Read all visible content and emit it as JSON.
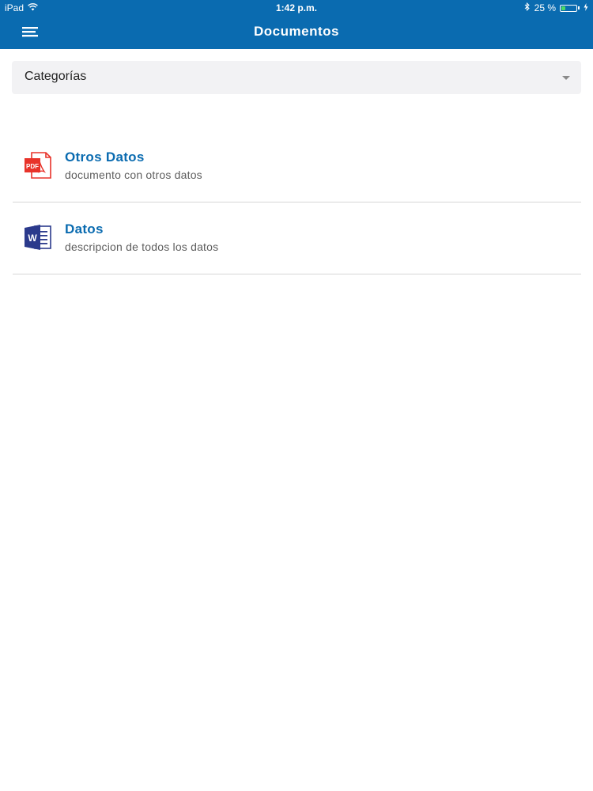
{
  "status_bar": {
    "device": "iPad",
    "time": "1:42 p.m.",
    "battery": "25 %",
    "battery_level": 0.25,
    "icons": [
      "wifi-icon",
      "bluetooth-icon",
      "battery-icon",
      "charging-icon"
    ]
  },
  "nav": {
    "title": "Documentos",
    "menu_icon": "menu-icon"
  },
  "category_select": {
    "label": "Categorías",
    "caret_icon": "chevron-down-icon"
  },
  "documents": [
    {
      "title": "Otros Datos",
      "description": "documento con otros datos",
      "icon": "pdf-file-icon",
      "icon_color": "#e8332a",
      "icon_label": "PDF"
    },
    {
      "title": "Datos",
      "description": "descripcion de todos los datos",
      "icon": "word-file-icon",
      "icon_color": "#2b3a8c",
      "icon_label": "W"
    }
  ],
  "colors": {
    "brand": "#0a6bb0",
    "title_link": "#0a6bb0",
    "select_bg": "#f2f2f4",
    "divider": "#d6d6d6"
  }
}
